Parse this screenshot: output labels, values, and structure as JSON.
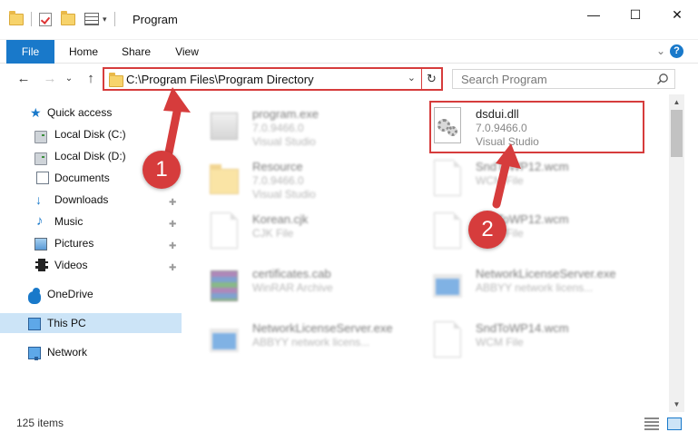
{
  "window": {
    "title": "Program",
    "minimize_glyph": "—",
    "maximize_glyph": "☐",
    "close_glyph": "✕"
  },
  "ribbon": {
    "tabs": [
      "File",
      "Home",
      "Share",
      "View"
    ],
    "collapse_glyph": "⌄",
    "help_glyph": "?"
  },
  "address": {
    "back_glyph": "←",
    "forward_glyph": "→",
    "recent_glyph": "⌄",
    "up_glyph": "↑",
    "path": "C:\\Program Files\\Program Directory",
    "dropdown_glyph": "⌄",
    "refresh_glyph": "↻"
  },
  "search": {
    "placeholder": "Search Program"
  },
  "nav": {
    "items": [
      {
        "label": "Quick access",
        "icon": "star-icon"
      },
      {
        "label": "Local Disk (C:)",
        "icon": "disk-icon"
      },
      {
        "label": "Local Disk (D:)",
        "icon": "disk-icon"
      },
      {
        "label": "Documents",
        "icon": "documents-icon"
      },
      {
        "label": "Downloads",
        "icon": "downloads-icon"
      },
      {
        "label": "Music",
        "icon": "music-icon"
      },
      {
        "label": "Pictures",
        "icon": "pictures-icon"
      },
      {
        "label": "Videos",
        "icon": "videos-icon"
      },
      {
        "label": "OneDrive",
        "icon": "onedrive-icon"
      },
      {
        "label": "This PC",
        "icon": "this-pc-icon"
      },
      {
        "label": "Network",
        "icon": "network-icon"
      }
    ],
    "pin_glyph": "📌"
  },
  "files": [
    {
      "name": "program.exe",
      "line2": "7.0.9466.0",
      "line3": "Visual Studio",
      "icon": "exe-icon"
    },
    {
      "name": "dsdui.dll",
      "line2": "7.0.9466.0",
      "line3": "Visual Studio",
      "icon": "dll-icon"
    },
    {
      "name": "Resource",
      "line2": "7.0.9466.0",
      "line3": "Visual Studio",
      "icon": "folder-icon"
    },
    {
      "name": "SndToWP12.wcm",
      "line2": "WCM File",
      "line3": "",
      "icon": "file-icon"
    },
    {
      "name": "Korean.cjk",
      "line2": "CJK File",
      "line3": "",
      "icon": "file-icon"
    },
    {
      "name": "SndToWP12.wcm",
      "line2": "WCM File",
      "line3": "",
      "icon": "file-icon"
    },
    {
      "name": "certificates.cab",
      "line2": "WinRAR Archive",
      "line3": "",
      "icon": "archive-icon"
    },
    {
      "name": "NetworkLicenseServer.exe",
      "line2": "ABBYY network licens...",
      "line3": "",
      "icon": "app-icon"
    },
    {
      "name": "NetworkLicenseServer.exe",
      "line2": "ABBYY network licens...",
      "line3": "",
      "icon": "app-icon"
    },
    {
      "name": "SndToWP14.wcm",
      "line2": "WCM File",
      "line3": "",
      "icon": "file-icon"
    }
  ],
  "status": {
    "item_count": "125 items"
  },
  "callouts": [
    "1",
    "2"
  ],
  "colors": {
    "accent": "#1979ca",
    "highlight_red": "#d63c3c",
    "selection": "#cce4f7"
  }
}
